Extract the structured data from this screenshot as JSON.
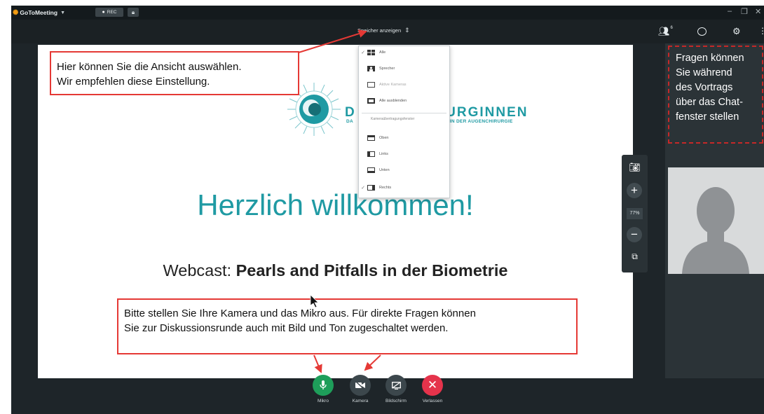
{
  "titlebar": {
    "app_name": "GoToMeeting",
    "rec_label": "REC",
    "window_controls": [
      "–",
      "❐",
      "✕"
    ]
  },
  "header": {
    "speaker_selector_label": "Speicher anzeigen",
    "people_count": "6"
  },
  "view_menu": {
    "items": [
      {
        "label": "Alle",
        "checked": true,
        "disabled": false,
        "icon": "grid-icon"
      },
      {
        "label": "Sprecher",
        "checked": false,
        "disabled": false,
        "icon": "speaker-icon"
      },
      {
        "label": "Aktive Kameras",
        "checked": false,
        "disabled": true,
        "icon": "camera-frame-icon"
      },
      {
        "label": "Alle ausblenden",
        "checked": false,
        "disabled": false,
        "icon": "hide-all-icon"
      }
    ],
    "section_header": "Kameraübertragungsfenster",
    "position_items": [
      {
        "label": "Oben",
        "checked": false,
        "icon": "layout-top-icon"
      },
      {
        "label": "Links",
        "checked": false,
        "icon": "layout-left-icon"
      },
      {
        "label": "Unten",
        "checked": false,
        "icon": "layout-bottom-icon"
      },
      {
        "label": "Rechts",
        "checked": true,
        "icon": "layout-right-icon"
      }
    ]
  },
  "slide": {
    "brand_line1_visible": "D",
    "brand_line1_rest": "CHIRURGINNEN",
    "brand_line2_visible": "DA",
    "brand_line2_rest": "EN IN DER AUGENCHIRURGIE",
    "welcome": "Herzlich willkommen!",
    "webcast_prefix": "Webcast: ",
    "webcast_title": "Pearls and Pitfalls in der Biometrie",
    "callout_view_line1": "Hier können Sie die Ansicht auswählen.",
    "callout_view_line2": "Wir empfehlen diese Einstellung.",
    "callout_mic_line1": "Bitte stellen Sie Ihre Kamera und das Mikro aus. Für direkte Fragen können",
    "callout_mic_line2": "Sie zur Diskussionsrunde auch mit Bild und Ton zugeschaltet werden."
  },
  "zoom_toolbar": {
    "zoom_level": "77%"
  },
  "right_panel": {
    "callout_chat_lines": [
      "Fragen können",
      "Sie während",
      "des Vortrags",
      "über das Chat-",
      "fenster stellen"
    ]
  },
  "bottom_toolbar": {
    "buttons": [
      {
        "label": "Mikro",
        "color": "#1e9e5a",
        "icon": "microphone-icon"
      },
      {
        "label": "Kamera",
        "color": "#3c474c",
        "icon": "camera-off-icon"
      },
      {
        "label": "Bildschirm",
        "color": "#3c474c",
        "icon": "screen-share-icon"
      },
      {
        "label": "Verlassen",
        "color": "#e5334b",
        "icon": "close-icon"
      }
    ]
  },
  "colors": {
    "brand_teal": "#1f9aa3",
    "callout_red": "#e53935",
    "app_bg": "#1e2529"
  }
}
